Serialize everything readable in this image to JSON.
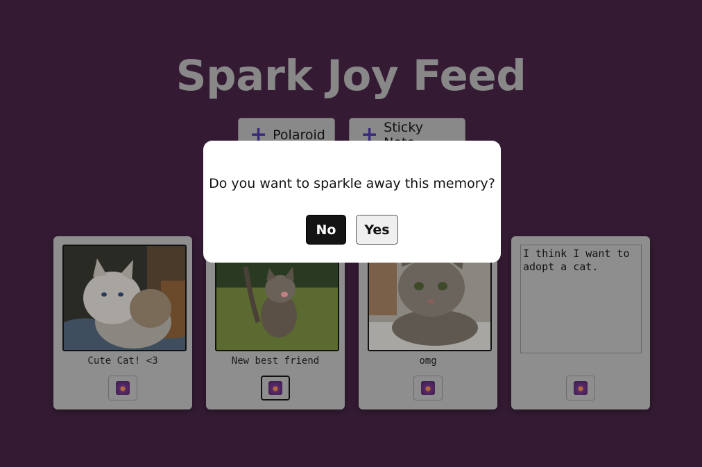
{
  "header": {
    "title": "Spark Joy Feed"
  },
  "toolbar": {
    "add_polaroid_label": "Polaroid",
    "add_sticky_label": "Sticky Note",
    "plus_glyph": "+"
  },
  "cards": [
    {
      "type": "polaroid",
      "caption": "Cute Cat! <3"
    },
    {
      "type": "polaroid",
      "caption": "New best friend"
    },
    {
      "type": "polaroid",
      "caption": "omg"
    },
    {
      "type": "sticky",
      "text": "I think I want to\nadopt a cat."
    }
  ],
  "modal": {
    "message": "Do you want to sparkle away this memory?",
    "no_label": "No",
    "yes_label": "Yes"
  },
  "colors": {
    "background": "#341b33",
    "overlay_gray": "#8e8e8e",
    "modal_bg": "#ffffff",
    "no_button": "#141414",
    "plus_accent": "#3a2a7a"
  }
}
